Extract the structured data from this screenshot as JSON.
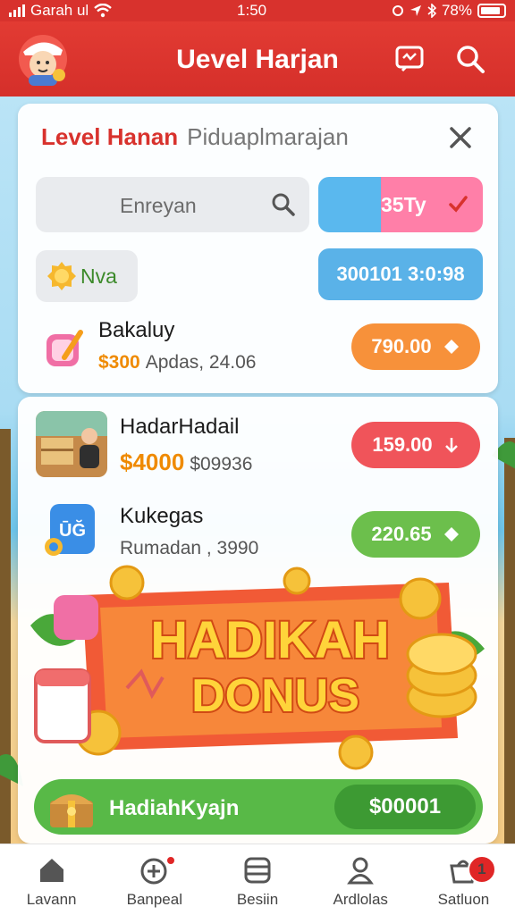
{
  "status_bar": {
    "carrier": "Garah ul",
    "time": "1:50",
    "battery": "78%"
  },
  "header": {
    "title": "Uevel Harjan",
    "icons": [
      "mascot-avatar",
      "chat-icon",
      "search-icon"
    ]
  },
  "panel": {
    "title_primary": "Level Hanan",
    "title_secondary": "Piduaplmarajan",
    "search_value": "Enreyan",
    "toggle_label": "35Ty",
    "level_label": "Nva",
    "timer_label": "300101 3:0:98"
  },
  "items": [
    {
      "name": "Bakaluy",
      "price": "$300",
      "detail": "Apdas, 24.06",
      "button": "790.00",
      "button_color": "#f7913a"
    },
    {
      "name": "HadarHadail",
      "price": "$4000",
      "detail": "$09936",
      "button": "159.00",
      "button_color": "#f0545a"
    },
    {
      "name": "Kukegas",
      "price": "",
      "detail": "Rumadan , 3990",
      "button": "220.65",
      "button_color": "#6cbf4c"
    }
  ],
  "banner": {
    "line1": "HADIKAH",
    "line2": "DONUS"
  },
  "bonus": {
    "label": "HadiahKyajn",
    "amount": "$00001"
  },
  "nav": [
    {
      "label": "Lavann",
      "icon": "home-icon"
    },
    {
      "label": "Banpeal",
      "icon": "add-circle-icon"
    },
    {
      "label": "Besiin",
      "icon": "list-icon"
    },
    {
      "label": "Ardlolas",
      "icon": "profile-icon"
    },
    {
      "label": "Satluon",
      "icon": "cart-icon",
      "badge": "1"
    }
  ],
  "colors": {
    "brand_red": "#d8322d",
    "green": "#58b947",
    "blue": "#5ab2e8",
    "pink": "#ff7fa8",
    "orange": "#f7913a"
  }
}
